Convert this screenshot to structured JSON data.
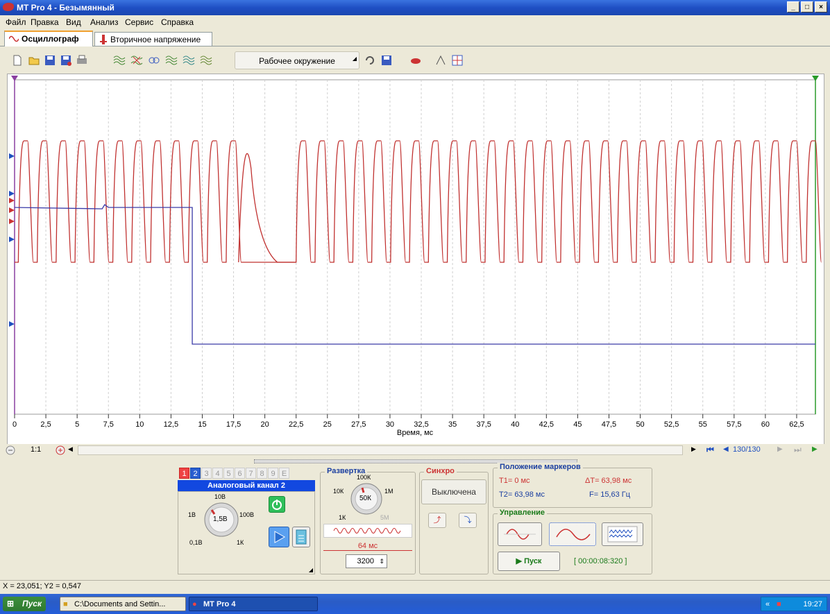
{
  "window": {
    "title": "MT Pro 4 - Безымянный"
  },
  "menu": [
    "Файл",
    "Правка",
    "Вид",
    "Анализ",
    "Сервис",
    "Справка"
  ],
  "tabs": [
    {
      "label": "Осциллограф",
      "active": true
    },
    {
      "label": "Вторичное напряжение",
      "active": false
    }
  ],
  "toolbar": {
    "workspace_label": "Рабочее окружение"
  },
  "plot": {
    "x_axis_label": "Время, мс",
    "ticks": [
      "0",
      "2,5",
      "5",
      "7,5",
      "10",
      "12,5",
      "15",
      "17,5",
      "20",
      "22,5",
      "25",
      "27,5",
      "30",
      "32,5",
      "35",
      "37,5",
      "40",
      "42,5",
      "45",
      "47,5",
      "50",
      "52,5",
      "55",
      "57,5",
      "60",
      "62,5"
    ]
  },
  "scroll": {
    "ratio": "1:1",
    "page": "130/130"
  },
  "channel_panel": {
    "tabs": [
      "1",
      "2",
      "3",
      "4",
      "5",
      "6",
      "7",
      "8",
      "9",
      "E"
    ],
    "active": "2",
    "title": "Аналоговый канал 2",
    "knob_labels": {
      "top": "10В",
      "left": "1В",
      "right": "100В",
      "bl": "0,1В",
      "br": "1К",
      "center": "1,5В"
    }
  },
  "sweep_panel": {
    "title": "Развертка",
    "knob_labels": {
      "top": "100К",
      "left": "10К",
      "right": "1М",
      "bl": "1К",
      "br": "5М",
      "center": "50К"
    },
    "time": "64 мс",
    "points": "3200"
  },
  "sync_panel": {
    "title": "Синхро",
    "state": "Выключена"
  },
  "markers_panel": {
    "title": "Положение маркеров",
    "t1": "T1= 0 мс",
    "dt": "ΔT= 63,98 мс",
    "t2": "T2= 63,98 мс",
    "f": "F= 15,63 Гц"
  },
  "control_panel": {
    "title": "Управление",
    "start": "Пуск",
    "timer": "[ 00:00:08:320 ]"
  },
  "status": {
    "coords": "X = 23,051; Y2 = 0,547"
  },
  "taskbar": {
    "start": "Пуск",
    "tasks": [
      "C:\\Documents and Settin...",
      "MT Pro 4"
    ],
    "clock": "19:27",
    "expand": "«"
  },
  "colors": {
    "red_trace": "#c0302f",
    "blue_trace": "#3a3aa8"
  }
}
